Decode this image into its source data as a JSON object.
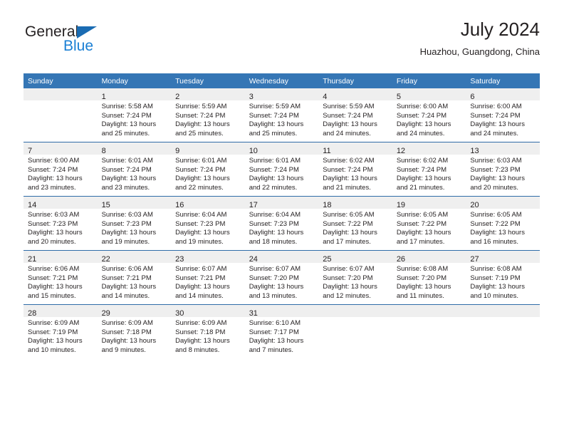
{
  "brand": {
    "name_top": "General",
    "name_bottom": "Blue",
    "triangle_icon": "triangle-icon",
    "color_top": "#231f20",
    "color_bottom": "#1a7fd4",
    "triangle_color": "#1a6cb3"
  },
  "header": {
    "title": "July 2024",
    "subtitle": "Huazhou, Guangdong, China"
  },
  "theme": {
    "header_bg": "#3576b5",
    "daynum_band_bg": "#efefef",
    "row_separator": "#2f6ca8",
    "text": "#231f20",
    "page_bg": "#ffffff"
  },
  "weekdays": [
    "Sunday",
    "Monday",
    "Tuesday",
    "Wednesday",
    "Thursday",
    "Friday",
    "Saturday"
  ],
  "weeks": [
    [
      {
        "day": ""
      },
      {
        "day": "1",
        "sunrise": "Sunrise: 5:58 AM",
        "sunset": "Sunset: 7:24 PM",
        "daylight1": "Daylight: 13 hours",
        "daylight2": "and 25 minutes."
      },
      {
        "day": "2",
        "sunrise": "Sunrise: 5:59 AM",
        "sunset": "Sunset: 7:24 PM",
        "daylight1": "Daylight: 13 hours",
        "daylight2": "and 25 minutes."
      },
      {
        "day": "3",
        "sunrise": "Sunrise: 5:59 AM",
        "sunset": "Sunset: 7:24 PM",
        "daylight1": "Daylight: 13 hours",
        "daylight2": "and 25 minutes."
      },
      {
        "day": "4",
        "sunrise": "Sunrise: 5:59 AM",
        "sunset": "Sunset: 7:24 PM",
        "daylight1": "Daylight: 13 hours",
        "daylight2": "and 24 minutes."
      },
      {
        "day": "5",
        "sunrise": "Sunrise: 6:00 AM",
        "sunset": "Sunset: 7:24 PM",
        "daylight1": "Daylight: 13 hours",
        "daylight2": "and 24 minutes."
      },
      {
        "day": "6",
        "sunrise": "Sunrise: 6:00 AM",
        "sunset": "Sunset: 7:24 PM",
        "daylight1": "Daylight: 13 hours",
        "daylight2": "and 24 minutes."
      }
    ],
    [
      {
        "day": "7",
        "sunrise": "Sunrise: 6:00 AM",
        "sunset": "Sunset: 7:24 PM",
        "daylight1": "Daylight: 13 hours",
        "daylight2": "and 23 minutes."
      },
      {
        "day": "8",
        "sunrise": "Sunrise: 6:01 AM",
        "sunset": "Sunset: 7:24 PM",
        "daylight1": "Daylight: 13 hours",
        "daylight2": "and 23 minutes."
      },
      {
        "day": "9",
        "sunrise": "Sunrise: 6:01 AM",
        "sunset": "Sunset: 7:24 PM",
        "daylight1": "Daylight: 13 hours",
        "daylight2": "and 22 minutes."
      },
      {
        "day": "10",
        "sunrise": "Sunrise: 6:01 AM",
        "sunset": "Sunset: 7:24 PM",
        "daylight1": "Daylight: 13 hours",
        "daylight2": "and 22 minutes."
      },
      {
        "day": "11",
        "sunrise": "Sunrise: 6:02 AM",
        "sunset": "Sunset: 7:24 PM",
        "daylight1": "Daylight: 13 hours",
        "daylight2": "and 21 minutes."
      },
      {
        "day": "12",
        "sunrise": "Sunrise: 6:02 AM",
        "sunset": "Sunset: 7:24 PM",
        "daylight1": "Daylight: 13 hours",
        "daylight2": "and 21 minutes."
      },
      {
        "day": "13",
        "sunrise": "Sunrise: 6:03 AM",
        "sunset": "Sunset: 7:23 PM",
        "daylight1": "Daylight: 13 hours",
        "daylight2": "and 20 minutes."
      }
    ],
    [
      {
        "day": "14",
        "sunrise": "Sunrise: 6:03 AM",
        "sunset": "Sunset: 7:23 PM",
        "daylight1": "Daylight: 13 hours",
        "daylight2": "and 20 minutes."
      },
      {
        "day": "15",
        "sunrise": "Sunrise: 6:03 AM",
        "sunset": "Sunset: 7:23 PM",
        "daylight1": "Daylight: 13 hours",
        "daylight2": "and 19 minutes."
      },
      {
        "day": "16",
        "sunrise": "Sunrise: 6:04 AM",
        "sunset": "Sunset: 7:23 PM",
        "daylight1": "Daylight: 13 hours",
        "daylight2": "and 19 minutes."
      },
      {
        "day": "17",
        "sunrise": "Sunrise: 6:04 AM",
        "sunset": "Sunset: 7:23 PM",
        "daylight1": "Daylight: 13 hours",
        "daylight2": "and 18 minutes."
      },
      {
        "day": "18",
        "sunrise": "Sunrise: 6:05 AM",
        "sunset": "Sunset: 7:22 PM",
        "daylight1": "Daylight: 13 hours",
        "daylight2": "and 17 minutes."
      },
      {
        "day": "19",
        "sunrise": "Sunrise: 6:05 AM",
        "sunset": "Sunset: 7:22 PM",
        "daylight1": "Daylight: 13 hours",
        "daylight2": "and 17 minutes."
      },
      {
        "day": "20",
        "sunrise": "Sunrise: 6:05 AM",
        "sunset": "Sunset: 7:22 PM",
        "daylight1": "Daylight: 13 hours",
        "daylight2": "and 16 minutes."
      }
    ],
    [
      {
        "day": "21",
        "sunrise": "Sunrise: 6:06 AM",
        "sunset": "Sunset: 7:21 PM",
        "daylight1": "Daylight: 13 hours",
        "daylight2": "and 15 minutes."
      },
      {
        "day": "22",
        "sunrise": "Sunrise: 6:06 AM",
        "sunset": "Sunset: 7:21 PM",
        "daylight1": "Daylight: 13 hours",
        "daylight2": "and 14 minutes."
      },
      {
        "day": "23",
        "sunrise": "Sunrise: 6:07 AM",
        "sunset": "Sunset: 7:21 PM",
        "daylight1": "Daylight: 13 hours",
        "daylight2": "and 14 minutes."
      },
      {
        "day": "24",
        "sunrise": "Sunrise: 6:07 AM",
        "sunset": "Sunset: 7:20 PM",
        "daylight1": "Daylight: 13 hours",
        "daylight2": "and 13 minutes."
      },
      {
        "day": "25",
        "sunrise": "Sunrise: 6:07 AM",
        "sunset": "Sunset: 7:20 PM",
        "daylight1": "Daylight: 13 hours",
        "daylight2": "and 12 minutes."
      },
      {
        "day": "26",
        "sunrise": "Sunrise: 6:08 AM",
        "sunset": "Sunset: 7:20 PM",
        "daylight1": "Daylight: 13 hours",
        "daylight2": "and 11 minutes."
      },
      {
        "day": "27",
        "sunrise": "Sunrise: 6:08 AM",
        "sunset": "Sunset: 7:19 PM",
        "daylight1": "Daylight: 13 hours",
        "daylight2": "and 10 minutes."
      }
    ],
    [
      {
        "day": "28",
        "sunrise": "Sunrise: 6:09 AM",
        "sunset": "Sunset: 7:19 PM",
        "daylight1": "Daylight: 13 hours",
        "daylight2": "and 10 minutes."
      },
      {
        "day": "29",
        "sunrise": "Sunrise: 6:09 AM",
        "sunset": "Sunset: 7:18 PM",
        "daylight1": "Daylight: 13 hours",
        "daylight2": "and 9 minutes."
      },
      {
        "day": "30",
        "sunrise": "Sunrise: 6:09 AM",
        "sunset": "Sunset: 7:18 PM",
        "daylight1": "Daylight: 13 hours",
        "daylight2": "and 8 minutes."
      },
      {
        "day": "31",
        "sunrise": "Sunrise: 6:10 AM",
        "sunset": "Sunset: 7:17 PM",
        "daylight1": "Daylight: 13 hours",
        "daylight2": "and 7 minutes."
      },
      {
        "day": ""
      },
      {
        "day": ""
      },
      {
        "day": ""
      }
    ]
  ]
}
